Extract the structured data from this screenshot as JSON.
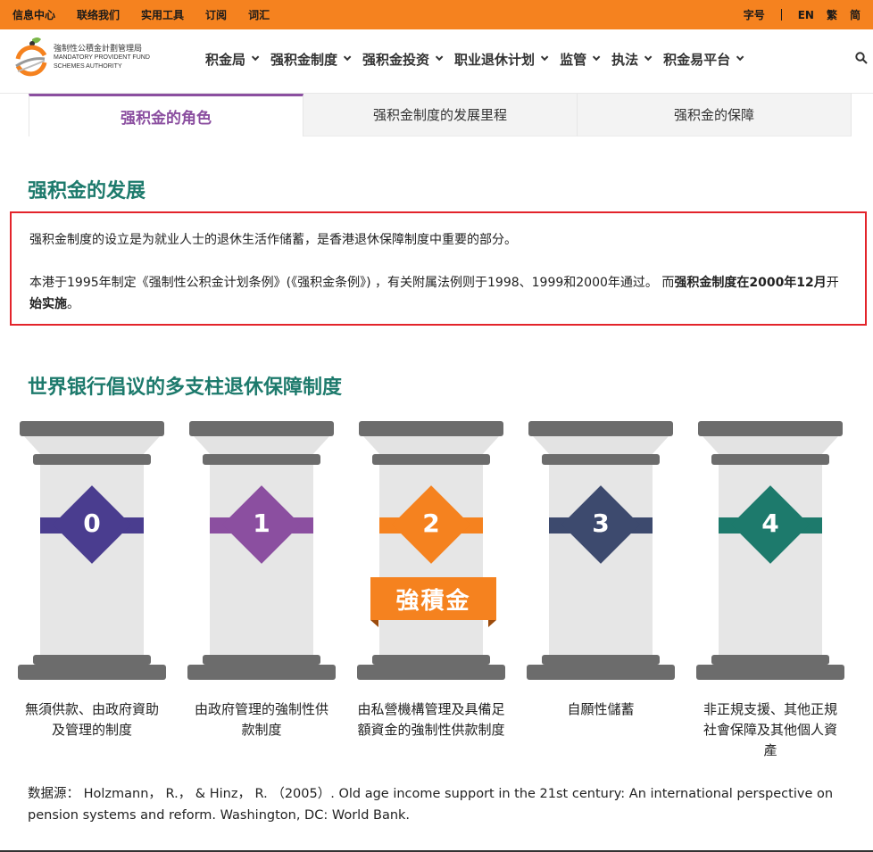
{
  "topbar": {
    "left_links": [
      "信息中心",
      "联络我们",
      "实用工具",
      "订阅",
      "词汇"
    ],
    "font_size_label": "字号",
    "lang_en": "EN",
    "lang_trad": "繁",
    "lang_simp": "简"
  },
  "logo": {
    "zh": "強制性公積金計劃管理局",
    "en1": "MANDATORY PROVIDENT FUND",
    "en2": "SCHEMES AUTHORITY"
  },
  "nav": [
    "积金局",
    "强积金制度",
    "强积金投资",
    "职业退休计划",
    "监管",
    "执法",
    "积金易平台"
  ],
  "tabs": [
    "强积金的角色",
    "强积金制度的发展里程",
    "强积金的保障"
  ],
  "section1": {
    "title": "强积金的发展",
    "para1": "强积金制度的设立是为就业人士的退休生活作储蓄，是香港退休保障制度中重要的部分。",
    "para2_a": "本港于1995年制定《强制性公积金计划条例》(《强积金条例》) ，有关附属法例则于1998、1999和2000年通过。 而",
    "para2_b1": "强积金制度在2000年12月",
    "para2_c": "开",
    "para2_b2": "始实施",
    "para2_d": "。"
  },
  "section2": {
    "title": "世界银行倡议的多支柱退休保障制度",
    "pillars": [
      {
        "num": "0",
        "color": "#4a3d8f",
        "caption": "無須供款、由政府資助及管理的制度"
      },
      {
        "num": "1",
        "color": "#8b4fa0",
        "caption": "由政府管理的強制性供款制度"
      },
      {
        "num": "2",
        "color": "#f5821f",
        "caption": "由私營機構管理及具備足額資金的強制性供款制度"
      },
      {
        "num": "3",
        "color": "#3d4a6e",
        "caption": "自願性儲蓄"
      },
      {
        "num": "4",
        "color": "#1d7a6c",
        "caption": "非正規支援、其他正規社會保障及其他個人資產"
      }
    ],
    "badge": "強積金"
  },
  "source": "数据源： Holzmann， R.， & Hinz， R. （2005）. Old age income support in the 21st century: An international perspective on pension systems and reform. Washington, DC: World Bank."
}
